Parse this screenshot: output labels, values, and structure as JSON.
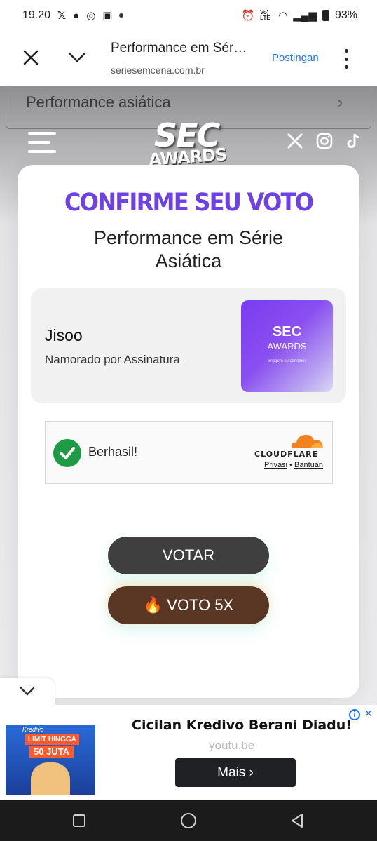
{
  "status_bar": {
    "time": "19.20",
    "battery": "93%",
    "network": "Vo) LTE"
  },
  "browser": {
    "page_title": "Performance em Sér…",
    "url": "seriesemcena.com.br",
    "action_label": "Postingan"
  },
  "background_page": {
    "category_row": "Performance asiática"
  },
  "site_header": {
    "logo_top": "SEC",
    "logo_bottom": "AWARDS",
    "social_icons": [
      "x-icon",
      "instagram-icon",
      "tiktok-icon"
    ]
  },
  "modal": {
    "title": "CONFIRME SEU VOTO",
    "category": "Performance em Série Asiática",
    "nominee": {
      "name": "Jisoo",
      "show": "Namorado por Assinatura",
      "image_line1": "SEC",
      "image_line2": "AWARDS",
      "image_caption": "imagem placeholder"
    },
    "captcha": {
      "status": "Berhasil!",
      "provider": "CLOUDFLARE",
      "privacy_link": "Privasi",
      "separator": "•",
      "help_link": "Bantuan"
    },
    "vote_button": "VOTAR",
    "vote5_button": "🔥 VOTO 5X"
  },
  "ad": {
    "title": "Cicilan Kredivo Berani Diadu!",
    "domain": "youtu.be",
    "cta": "Mais",
    "image_brand": "Kredivo",
    "image_badge": "LIMIT HINGGA",
    "image_amount": "50 JUTA"
  },
  "colors": {
    "accent_purple": "#6e41e2",
    "vote_button": "#3f3f3f",
    "vote5_button": "#5a3725",
    "success_green": "#1f9b45",
    "link_blue": "#1a73e8"
  }
}
